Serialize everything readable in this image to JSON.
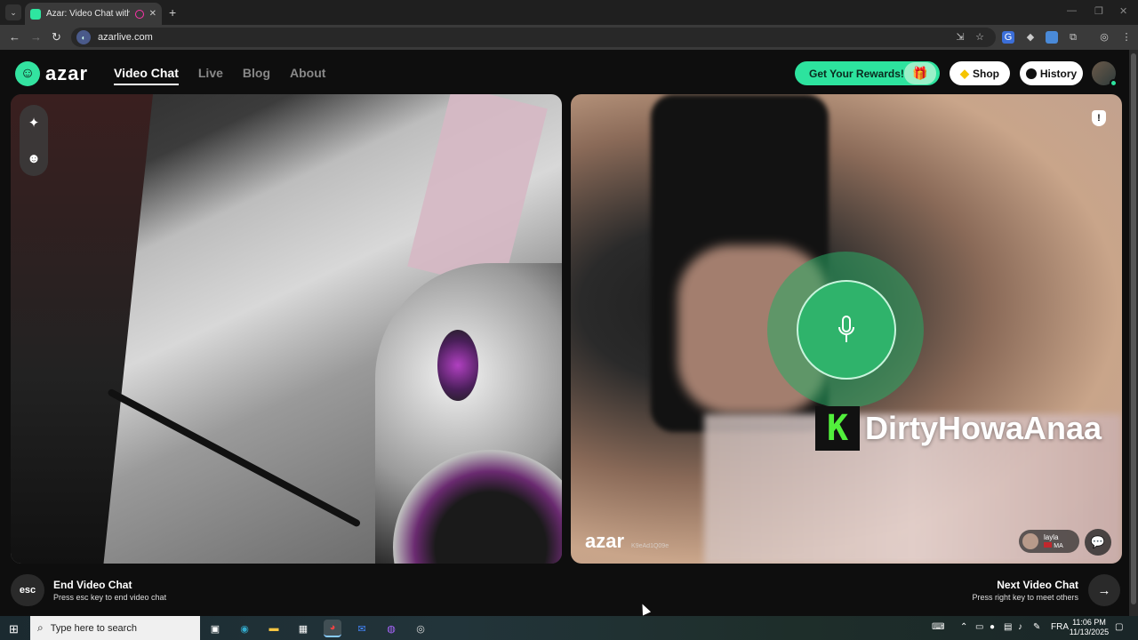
{
  "browser": {
    "tab_title": "Azar: Video Chat with New",
    "new_tab": "+",
    "url": "azarlive.com",
    "minimize": "—",
    "restore": "❐",
    "close": "✕"
  },
  "header": {
    "logo_text": "azar",
    "nav": [
      {
        "label": "Video Chat",
        "active": true
      },
      {
        "label": "Live"
      },
      {
        "label": "Blog"
      },
      {
        "label": "About"
      }
    ],
    "rewards_label": "Get Your Rewards!",
    "shop_label": "Shop",
    "history_label": "History"
  },
  "remote": {
    "streamer_overlay": "DirtyHowaAnaa",
    "overlay_logo_letter": "K",
    "watermark": "azar",
    "watermark_id": "K9eAd1Q09e",
    "partner_name": "layla",
    "partner_country": "MA"
  },
  "controls": {
    "esc_key": "esc",
    "end_title": "End Video Chat",
    "end_sub": "Press esc key to end video chat",
    "next_title": "Next Video Chat",
    "next_sub": "Press right key to meet others"
  },
  "taskbar": {
    "search_placeholder": "Type here to search",
    "language": "FRA",
    "time": "11:06 PM",
    "date": "11/13/2025"
  },
  "colors": {
    "accent": "#2de39e",
    "mic_green": "#2fb36b",
    "overlay_k": "#52f03c"
  }
}
